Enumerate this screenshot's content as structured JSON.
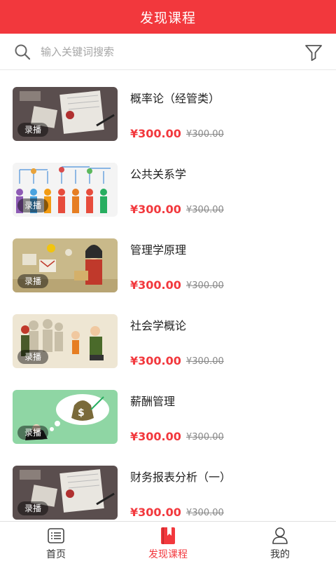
{
  "header": {
    "title": "发现课程"
  },
  "search": {
    "placeholder": "输入关键词搜索"
  },
  "courses": [
    {
      "title": "概率论（经管类）",
      "badge": "录播",
      "price": "¥300.00",
      "original_price": "¥300.00",
      "thumbnail": "desk-notebook"
    },
    {
      "title": "公共关系学",
      "badge": "录播",
      "price": "¥300.00",
      "original_price": "¥300.00",
      "thumbnail": "people-network"
    },
    {
      "title": "管理学原理",
      "badge": "录播",
      "price": "¥300.00",
      "original_price": "¥300.00",
      "thumbnail": "presenter-woman"
    },
    {
      "title": "社会学概论",
      "badge": "录播",
      "price": "¥300.00",
      "original_price": "¥300.00",
      "thumbnail": "family-group"
    },
    {
      "title": "薪酬管理",
      "badge": "录播",
      "price": "¥300.00",
      "original_price": "¥300.00",
      "thumbnail": "money-bag"
    },
    {
      "title": "财务报表分析（一）",
      "badge": "录播",
      "price": "¥300.00",
      "original_price": "¥300.00",
      "thumbnail": "desk-notebook"
    }
  ],
  "tabbar": {
    "items": [
      {
        "label": "首页",
        "icon": "list-icon",
        "active": false
      },
      {
        "label": "发现课程",
        "icon": "bookmark-book-icon",
        "active": true
      },
      {
        "label": "我的",
        "icon": "user-icon",
        "active": false
      }
    ]
  },
  "colors": {
    "brand": "#f2383d",
    "price": "#f2383d",
    "placeholder": "#a6a6a6"
  }
}
